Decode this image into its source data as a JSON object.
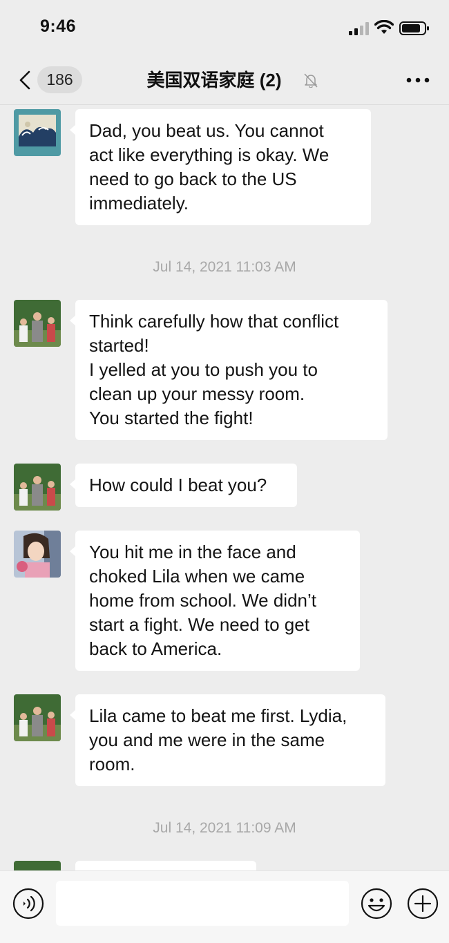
{
  "status_bar": {
    "time": "9:46"
  },
  "nav": {
    "unread_count": "186",
    "title": "美国双语家庭 (2)"
  },
  "timestamps": [
    "Jul 14, 2021 11:03 AM",
    "Jul 14, 2021 11:09 AM"
  ],
  "messages": [
    {
      "lines": [
        "Dad, you beat us. You cannot",
        "act like everything is okay. We",
        "need to go back to the US",
        "immediately."
      ]
    },
    {
      "lines": [
        "Think carefully how that conflict",
        "started!",
        "I yelled at you to push you to",
        "clean up your messy room.",
        "You started the fight!"
      ]
    },
    {
      "lines": [
        "How could I beat you?"
      ]
    },
    {
      "lines": [
        "You hit me in the face and",
        "choked Lila when we came",
        "home from school. We didn’t",
        "start a fight. We need to get",
        "back to America."
      ]
    },
    {
      "lines": [
        "Lila came to beat me first. Lydia,",
        "you and me were in the same",
        "room."
      ]
    }
  ],
  "colors": {
    "background": "#ededed",
    "bubble": "#ffffff",
    "timestamp": "#a8a8a8"
  },
  "icons": {
    "back": "chevron-left-icon",
    "mute": "bell-slash-icon",
    "more": "ellipsis-icon",
    "voice": "voice-icon",
    "emoji": "emoji-icon",
    "plus": "plus-circle-icon"
  }
}
